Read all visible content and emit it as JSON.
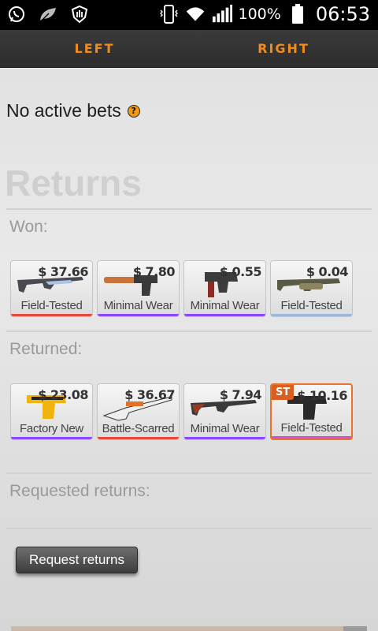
{
  "status_bar": {
    "battery_percent": "100%",
    "time": "06:53",
    "icons": [
      "whatsapp-icon",
      "leaf-icon",
      "shield-hand-icon",
      "vibrate-icon",
      "wifi-icon",
      "signal-icon",
      "battery-icon"
    ]
  },
  "tabs": [
    {
      "label": "LEFT"
    },
    {
      "label": "RIGHT"
    }
  ],
  "colors": {
    "tab_text": "#f08c1e",
    "rarity_red": "#e4493c",
    "rarity_purple": "#8a47ff",
    "rarity_pink": "#d84ad8",
    "rarity_blue": "#9bb8d8",
    "stattrak": "#d85e21"
  },
  "bets": {
    "status_text": "No active bets",
    "help_icon": "?"
  },
  "returns": {
    "title": "Returns",
    "won": {
      "label": "Won:",
      "items": [
        {
          "price": "$ 37.66",
          "wear": "Field-Tested",
          "rarity": "red"
        },
        {
          "price": "$ 7.80",
          "wear": "Minimal Wear",
          "rarity": "purple"
        },
        {
          "price": "$ 0.55",
          "wear": "Minimal Wear",
          "rarity": "purple"
        },
        {
          "price": "$ 0.04",
          "wear": "Field-Tested",
          "rarity": "blue"
        }
      ]
    },
    "returned": {
      "label": "Returned:",
      "items": [
        {
          "price": "$ 23.08",
          "wear": "Factory New",
          "rarity": "purple"
        },
        {
          "price": "$ 36.67",
          "wear": "Battle-Scarred",
          "rarity": "red"
        },
        {
          "price": "$ 7.94",
          "wear": "Minimal Wear",
          "rarity": "purple"
        },
        {
          "price": "$ 10.16",
          "wear": "Field-Tested",
          "rarity": "pink",
          "badge": "ST"
        }
      ]
    },
    "requested": {
      "label": "Requested returns:"
    },
    "request_button": "Request returns"
  }
}
